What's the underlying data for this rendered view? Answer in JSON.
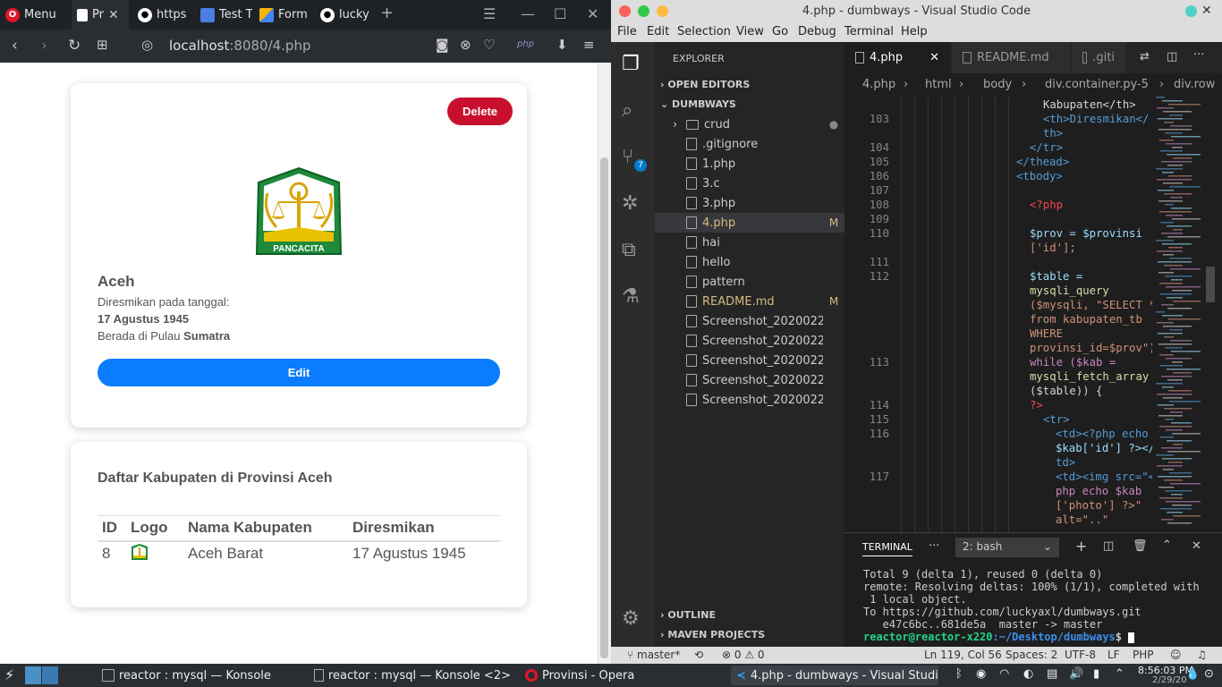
{
  "browser": {
    "menu_label": "Menu",
    "tabs": [
      {
        "label": "Pr",
        "icon": "page-icon"
      },
      {
        "label": "https",
        "icon": "github-icon"
      },
      {
        "label": "Test T",
        "icon": "doc-icon"
      },
      {
        "label": "Form",
        "icon": "form-icon"
      },
      {
        "label": "lucky",
        "icon": "github-icon"
      }
    ],
    "url_host": "localhost",
    "url_rest": ":8080/4.php",
    "page": {
      "delete_label": "Delete",
      "edit_label": "Edit",
      "logo_text": "PANCACITA",
      "province_name": "Aceh",
      "inaugurated_label": "Diresmikan pada tanggal:",
      "inaugurated_date": "17 Agustus 1945",
      "island_prefix": "Berada di Pulau ",
      "island_name": "Sumatra",
      "regency_title": "Daftar Kabupaten di Provinsi Aceh",
      "table": {
        "headers": [
          "ID",
          "Logo",
          "Nama Kabupaten",
          "Diresmikan"
        ],
        "rows": [
          {
            "id": "8",
            "name": "Aceh Barat",
            "date": "17 Agustus 1945"
          }
        ]
      }
    }
  },
  "vscode": {
    "title": "4.php - dumbways - Visual Studio Code",
    "menu": [
      "File",
      "Edit",
      "Selection",
      "View",
      "Go",
      "Debug",
      "Terminal",
      "Help"
    ],
    "explorer_label": "EXPLORER",
    "open_editors_label": "OPEN EDITORS",
    "project_label": "DUMBWAYS",
    "files": [
      {
        "name": "crud",
        "badge": "●"
      },
      {
        "name": ".gitignore",
        "badge": ""
      },
      {
        "name": "1.php",
        "badge": ""
      },
      {
        "name": "3.c",
        "badge": ""
      },
      {
        "name": "3.php",
        "badge": ""
      },
      {
        "name": "4.php",
        "badge": "M"
      },
      {
        "name": "hai",
        "badge": ""
      },
      {
        "name": "hello",
        "badge": ""
      },
      {
        "name": "pattern",
        "badge": ""
      },
      {
        "name": "README.md",
        "badge": "M"
      },
      {
        "name": "Screenshot_20200229_...",
        "badge": ""
      },
      {
        "name": "Screenshot_20200229_...",
        "badge": ""
      },
      {
        "name": "Screenshot_20200229_...",
        "badge": ""
      },
      {
        "name": "Screenshot_20200229_...",
        "badge": ""
      },
      {
        "name": "Screenshot_20200229_...",
        "badge": ""
      }
    ],
    "outline_label": "OUTLINE",
    "maven_label": "MAVEN PROJECTS",
    "scm_badge": "7",
    "editor_tabs": [
      "4.php",
      "README.md",
      ".giti"
    ],
    "breadcrumbs": [
      "4.php",
      "html",
      "body",
      "div.container.py-5",
      "div.row"
    ],
    "line_numbers": [
      "103",
      "104",
      "105",
      "106",
      "107",
      "108",
      "109",
      "110",
      "111",
      "112",
      "113",
      "114",
      "115",
      "116",
      "117"
    ],
    "code_lines": [
      "Kabupaten</th>",
      "<th>Diresmikan</",
      "th>",
      "</tr>",
      "</thead>",
      "<tbody>",
      "<?php",
      "$prov = $provinsi",
      "['id'];",
      "$table =",
      "mysqli_query",
      "($mysqli, \"SELECT *",
      "from kabupaten_tb",
      "WHERE",
      "provinsi_id=$prov\");",
      "while ($kab =",
      "mysqli_fetch_array",
      "($table)) {",
      "?>",
      "<tr>",
      "<td><?php echo",
      "$kab['id'] ?></",
      "td>",
      "<td><img src=\"<?",
      "php echo $kab",
      "['photo'] ?>\"",
      "alt=\"..\""
    ],
    "terminal": {
      "tab_label": "TERMINAL",
      "shell": "2: bash",
      "lines": [
        "Total 9 (delta 1), reused 0 (delta 0)",
        "remote: Resolving deltas: 100% (1/1), completed with",
        " 1 local object.",
        "To https://github.com/luckyaxl/dumbways.git",
        "   e47c6bc..681de5a  master -> master"
      ],
      "prompt_user": "reactor@reactor-x220",
      "prompt_path": ":~/Desktop/dumbways",
      "prompt_suffix": "$"
    },
    "status": {
      "branch": "master*",
      "problems": "0",
      "warnings": "0",
      "position": "Ln 119, Col 56",
      "spaces": "Spaces: 2",
      "encoding": "UTF-8",
      "eol": "LF",
      "language": "PHP"
    }
  },
  "taskbar": {
    "tasks": [
      "reactor : mysql — Konsole",
      "reactor : mysql — Konsole <2>",
      "Provinsi - Opera",
      "4.php - dumbways - Visual Studi..."
    ],
    "time": "8:56:03 PM",
    "date": "2/29/20"
  },
  "colors": {
    "delete": "#c8102e",
    "edit": "#0a7cff",
    "vscode_accent": "#007acc"
  }
}
